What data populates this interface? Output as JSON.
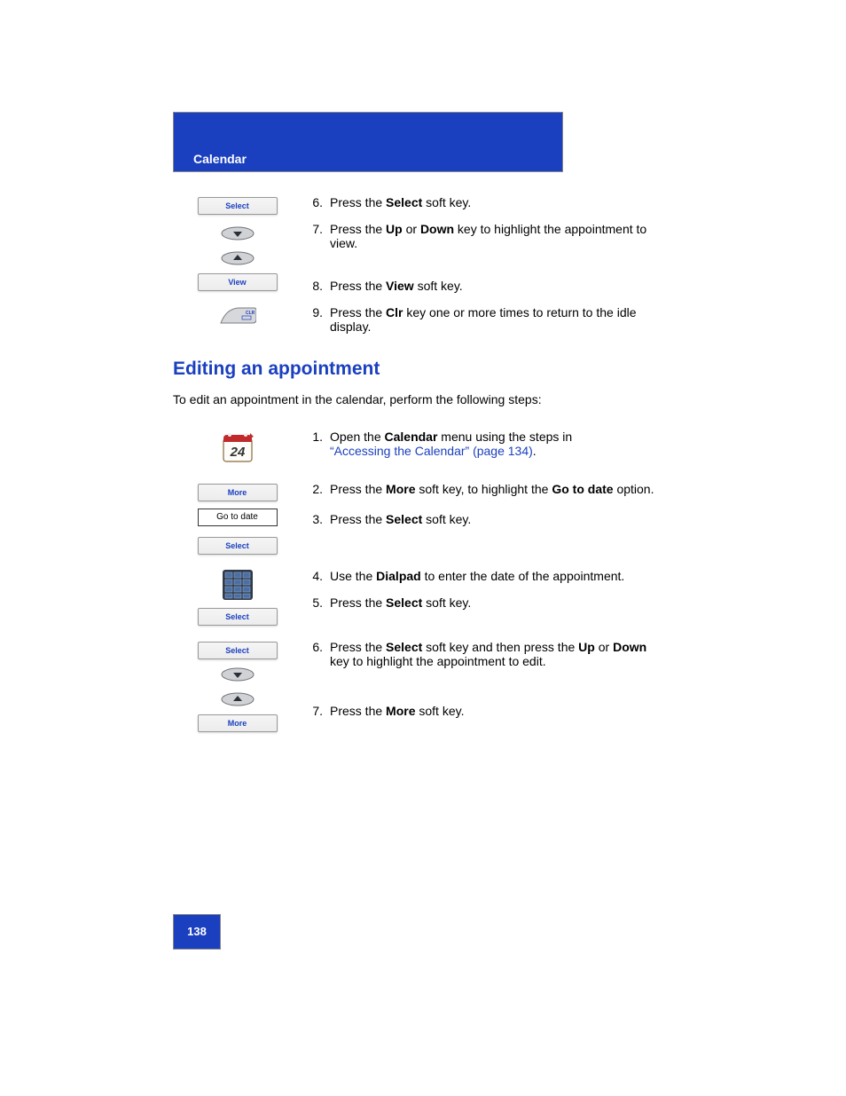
{
  "header": {
    "section": "Calendar"
  },
  "top_steps": [
    {
      "n": "6.",
      "text_before": "Press the ",
      "key": "Select",
      "text_after": " soft key."
    },
    {
      "n": "7.",
      "text_before": "Press the ",
      "key": "Up",
      "text_mid": " or ",
      "key2": "Down",
      "text_after": " key to highlight the appointment to view."
    },
    {
      "n": "8.",
      "text_before": "Press the ",
      "key": "View",
      "text_after": " soft key."
    },
    {
      "n": "9.",
      "text_before": "Press the ",
      "key": "Clr",
      "text_after": " key one or more times to return to the idle display."
    }
  ],
  "softkeys_top": {
    "select": "Select",
    "view": "View"
  },
  "section": {
    "title": "Editing an appointment",
    "intro": "To edit an appointment in the calendar, perform the following steps:"
  },
  "bottom": {
    "softkeys": {
      "more": "More",
      "goto": "Go to date",
      "select": "Select"
    },
    "steps": {
      "s1a": "Open the ",
      "s1b": "Calendar",
      "s1c": " menu using the steps in ",
      "s1link": "“Accessing the Calendar” (page 134)",
      "s1d": ".",
      "s2a": "Press the ",
      "s2b": "More",
      "s2c": " soft key, to highlight the ",
      "s2d": "Go to date",
      "s2e": " option.",
      "s3a": "Press the ",
      "s3b": "Select",
      "s3c": " soft key.",
      "s4a": "Use the ",
      "s4b": "Dialpad",
      "s4c": " to enter the date of the appointment.",
      "s5a": "Press the ",
      "s5b": "Select",
      "s5c": " soft key.",
      "s6a": "Press the ",
      "s6b": "Select",
      "s6c": " soft key and then press the ",
      "s6d": "Up",
      "s6e": " or ",
      "s6f": "Down",
      "s6g": " key to highlight the appointment to edit.",
      "s7a": "Press the ",
      "s7b": "More",
      "s7c": " soft key."
    }
  },
  "page": "138"
}
